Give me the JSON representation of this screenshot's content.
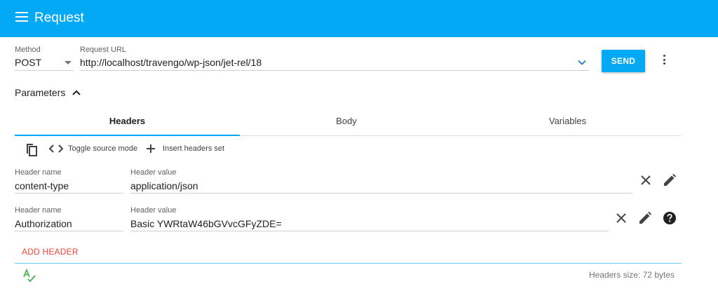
{
  "header": {
    "title": "Request",
    "menu_icon": "menu-icon"
  },
  "request": {
    "method_label": "Method",
    "method_value": "POST",
    "url_label": "Request URL",
    "url_value": "http://localhost/travengo/wp-json/jet-rel/18",
    "send_label": "SEND",
    "more_icon": "more-vert-icon"
  },
  "parameters": {
    "label": "Parameters",
    "toggle_icon": "chevron-up-icon"
  },
  "tabs": [
    {
      "label": "Headers",
      "active": true
    },
    {
      "label": "Body",
      "active": false
    },
    {
      "label": "Variables",
      "active": false
    }
  ],
  "toolbar": {
    "copy_icon": "copy-icon",
    "toggle_source_label": "Toggle source mode",
    "insert_set_label": "Insert headers set"
  },
  "headers": [
    {
      "name_label": "Header name",
      "name": "content-type",
      "value_label": "Header value",
      "value": "application/json"
    },
    {
      "name_label": "Header name",
      "name": "Authorization",
      "value_label": "Header value",
      "value": "Basic YWRtaW46bGVvcGFyZDE="
    }
  ],
  "add_header_label": "ADD HEADER",
  "footer": {
    "headers_size": "Headers size: 72 bytes"
  },
  "colors": {
    "primary": "#03A9F4",
    "accent": "#F44336",
    "spellcheck": "#4CAF50"
  }
}
